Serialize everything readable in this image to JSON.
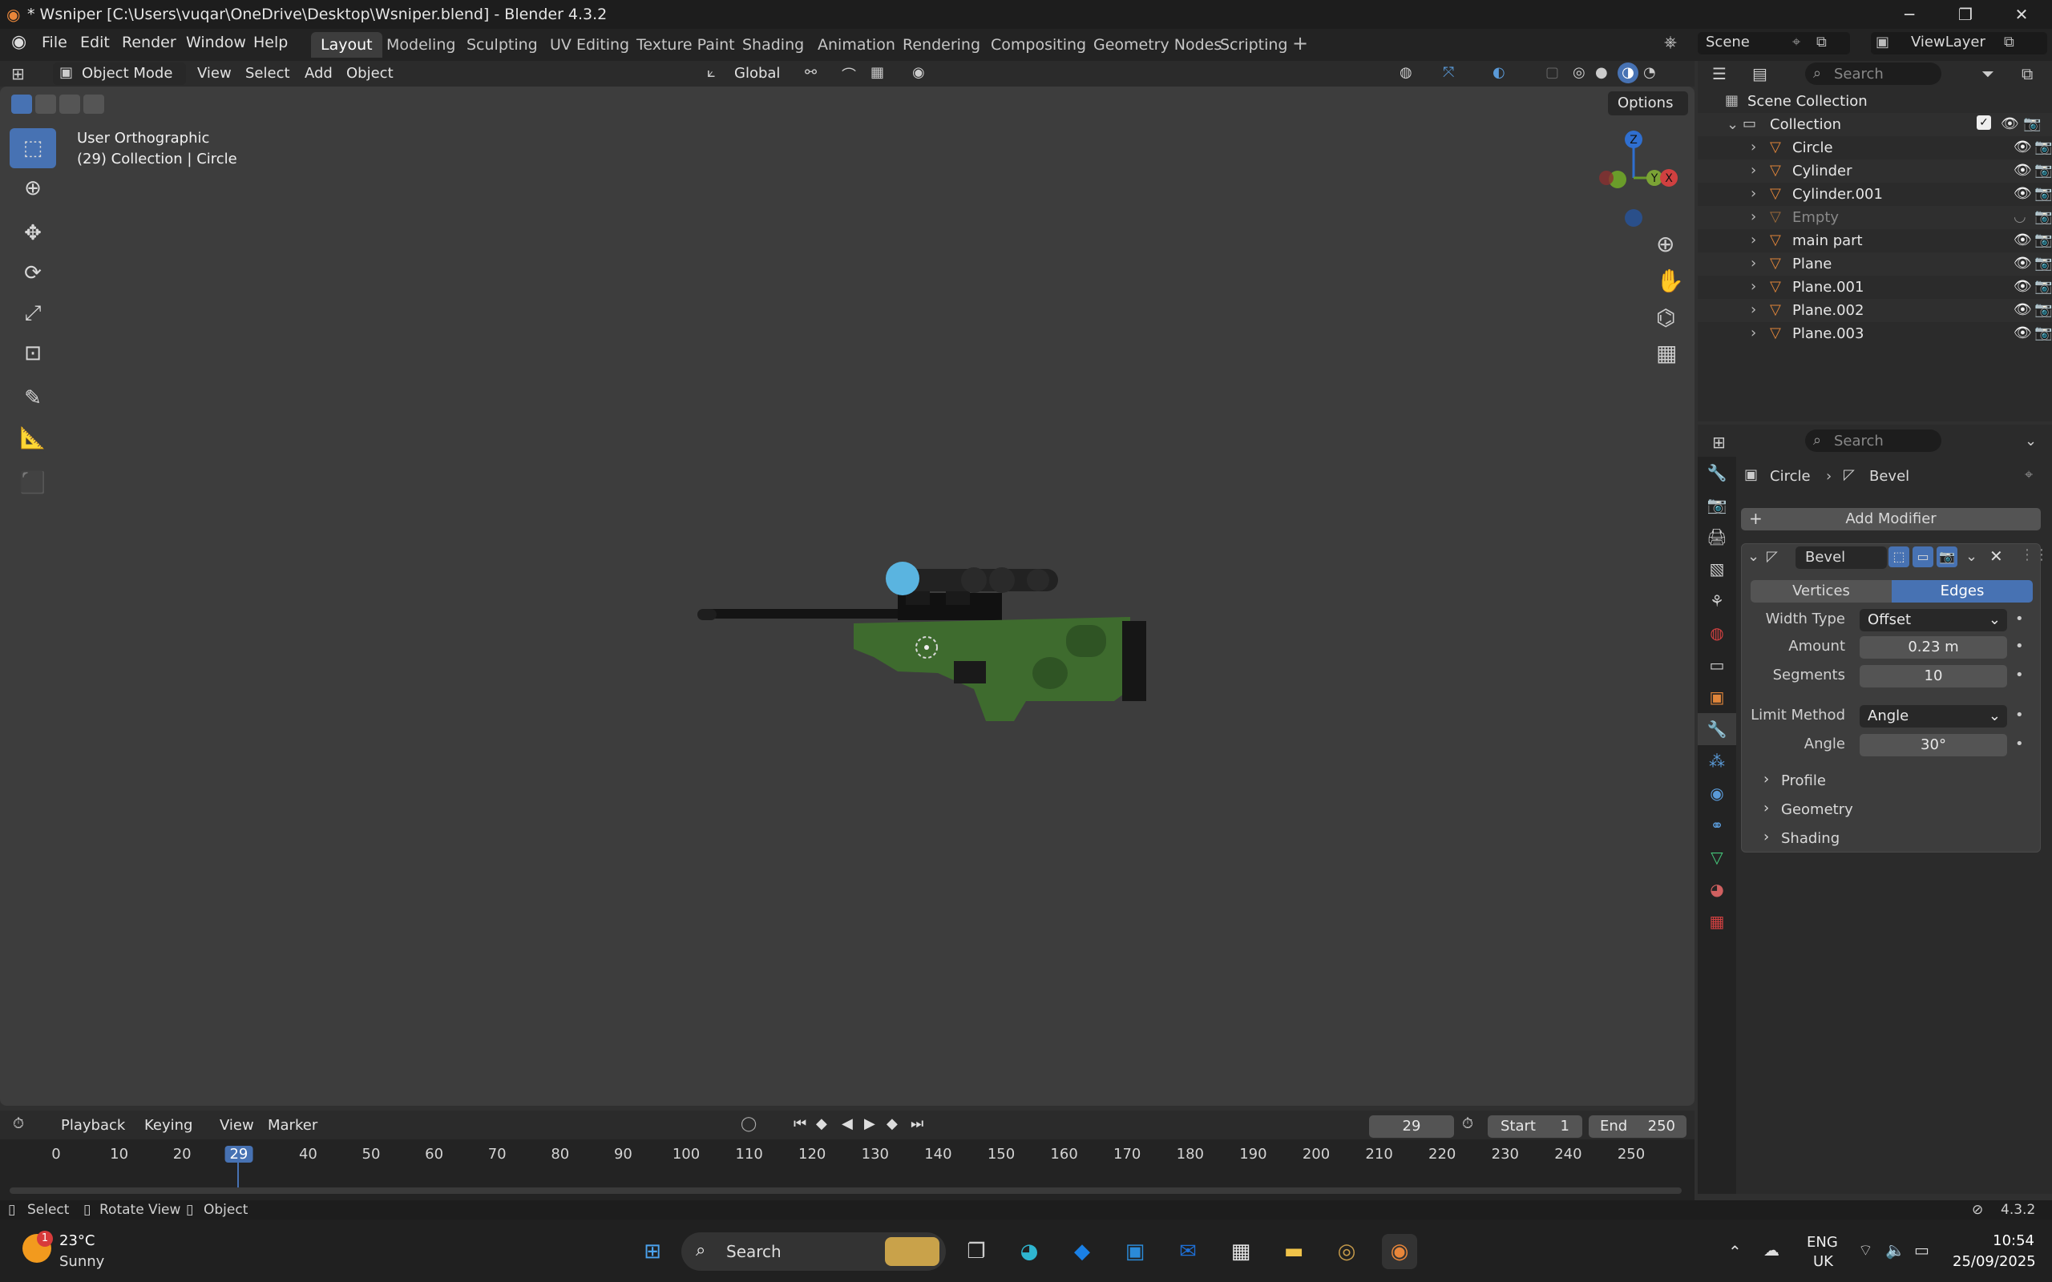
{
  "window": {
    "title": "* Wsniper [C:\\Users\\vuqar\\OneDrive\\Desktop\\Wsniper.blend] - Blender 4.3.2"
  },
  "menu": {
    "file": "File",
    "edit": "Edit",
    "render": "Render",
    "window": "Window",
    "help": "Help"
  },
  "workspaces": [
    "Layout",
    "Modeling",
    "Sculpting",
    "UV Editing",
    "Texture Paint",
    "Shading",
    "Animation",
    "Rendering",
    "Compositing",
    "Geometry Nodes",
    "Scripting"
  ],
  "scene": {
    "label": "Scene",
    "viewlayer": "ViewLayer"
  },
  "viewport_header": {
    "mode": "Object Mode",
    "view": "View",
    "select": "Select",
    "add": "Add",
    "object": "Object",
    "orientation": "Global",
    "options": "Options"
  },
  "viewport": {
    "view_name": "User Orthographic",
    "context": "(29) Collection | Circle",
    "gizmo": {
      "z": "Z",
      "y": "Y",
      "x": "X"
    }
  },
  "outliner": {
    "search_placeholder": "Search",
    "scene_collection": "Scene Collection",
    "collection": "Collection",
    "items": [
      {
        "name": "Circle",
        "muted": false
      },
      {
        "name": "Cylinder",
        "muted": false
      },
      {
        "name": "Cylinder.001",
        "muted": false
      },
      {
        "name": "Empty",
        "muted": true
      },
      {
        "name": "main part",
        "muted": false
      },
      {
        "name": "Plane",
        "muted": false
      },
      {
        "name": "Plane.001",
        "muted": false
      },
      {
        "name": "Plane.002",
        "muted": false
      },
      {
        "name": "Plane.003",
        "muted": false
      }
    ]
  },
  "properties": {
    "search_placeholder": "Search",
    "breadcrumb_object": "Circle",
    "breadcrumb_modifier": "Bevel",
    "add_modifier": "Add Modifier",
    "modifier": {
      "name": "Bevel",
      "affect_vertices": "Vertices",
      "affect_edges": "Edges",
      "width_type_label": "Width Type",
      "width_type": "Offset",
      "amount_label": "Amount",
      "amount": "0.23 m",
      "segments_label": "Segments",
      "segments": "10",
      "limit_method_label": "Limit Method",
      "limit_method": "Angle",
      "angle_label": "Angle",
      "angle": "30°",
      "panels": [
        "Profile",
        "Geometry",
        "Shading"
      ]
    }
  },
  "timeline": {
    "playback": "Playback",
    "keying": "Keying",
    "view": "View",
    "marker": "Marker",
    "current_frame": "29",
    "start_label": "Start",
    "start": "1",
    "end_label": "End",
    "end": "250",
    "ticks": [
      "0",
      "10",
      "20",
      "29",
      "40",
      "50",
      "60",
      "70",
      "80",
      "90",
      "100",
      "110",
      "120",
      "130",
      "140",
      "150",
      "160",
      "170",
      "180",
      "190",
      "200",
      "210",
      "220",
      "230",
      "240",
      "250"
    ]
  },
  "statusbar": {
    "select": "Select",
    "rotate": "Rotate View",
    "object": "Object",
    "version": "4.3.2"
  },
  "taskbar": {
    "weather_temp": "23°C",
    "weather_desc": "Sunny",
    "weather_badge": "1",
    "search": "Search",
    "lang1": "ENG",
    "lang2": "UK",
    "time": "10:54",
    "date": "25/09/2025"
  },
  "colors": {
    "accent": "#4772b3",
    "rifle_green": "#3e6b2e",
    "scope_lens": "#5ab4e0",
    "object_orange": "#e0853a",
    "mesh_green": "#45c67a"
  }
}
